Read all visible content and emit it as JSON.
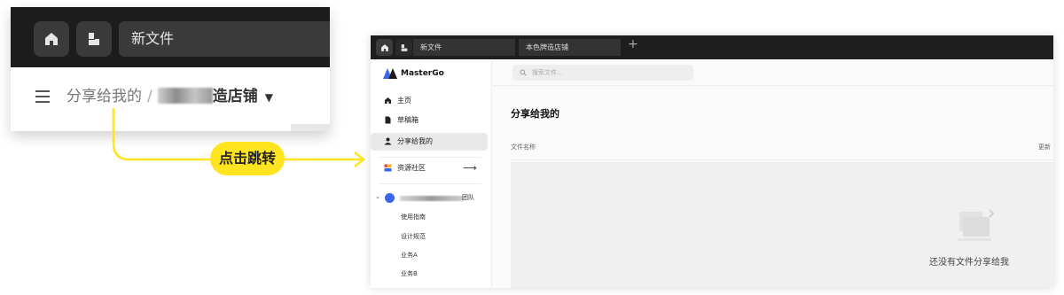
{
  "crop": {
    "tab_label": "新文件",
    "breadcrumb_parent": "分享给我的",
    "breadcrumb_separator": "/",
    "breadcrumb_current_visible": "造店铺"
  },
  "callout": {
    "label": "点击跳转"
  },
  "app": {
    "tabs": [
      "新文件",
      "本色牌造店铺"
    ],
    "new_tab": "+",
    "logo": "MasterGo",
    "search_placeholder": "搜索文件...",
    "sidebar": [
      {
        "label": "主页",
        "icon": "home-icon"
      },
      {
        "label": "草稿箱",
        "icon": "draft-file-icon"
      },
      {
        "label": "分享给我的",
        "icon": "user-icon",
        "active": true
      }
    ],
    "community": {
      "label": "资源社区",
      "icon": "community-icon",
      "arrow": "⟶"
    },
    "team": {
      "caret": "⌄",
      "name_suffix": "团队",
      "color": "#3b66e6"
    },
    "projects": [
      "使用指南",
      "设计规范",
      "业务A",
      "业务B"
    ],
    "page_title": "分享给我的",
    "columns": {
      "name": "文件名称",
      "updated": "更新"
    },
    "empty_text": "还没有文件分享给我"
  },
  "colors": {
    "accent_yellow": "#ffe41f",
    "team_blue": "#3b66e6",
    "topbar_dark": "#1e1e1e"
  }
}
